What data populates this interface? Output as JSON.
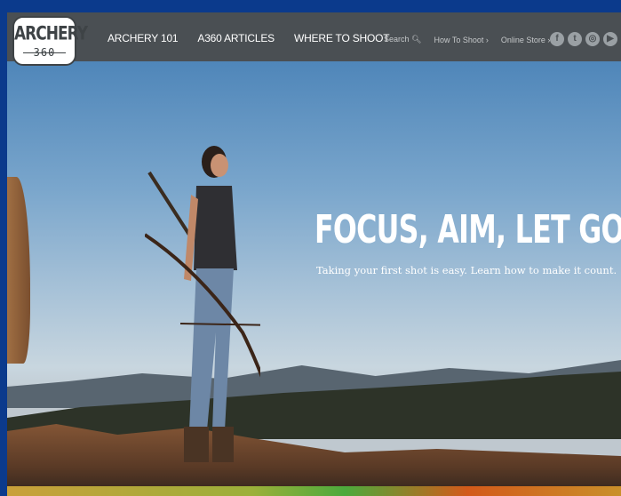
{
  "logo": {
    "top_text": "ARCHERY",
    "bottom_text": "360"
  },
  "nav": {
    "main": [
      "ARCHERY 101",
      "A360 ARTICLES",
      "WHERE TO SHOOT"
    ],
    "search_label": "Search",
    "how_to_shoot": "How To Shoot",
    "online_store": "Online Store"
  },
  "social": {
    "facebook": "f",
    "twitter": "t",
    "instagram": "◎",
    "youtube": "▶"
  },
  "hero": {
    "headline": "FOCUS, AIM, LET GO",
    "subhead": "Taking your first shot is easy. Learn how to make it count."
  }
}
